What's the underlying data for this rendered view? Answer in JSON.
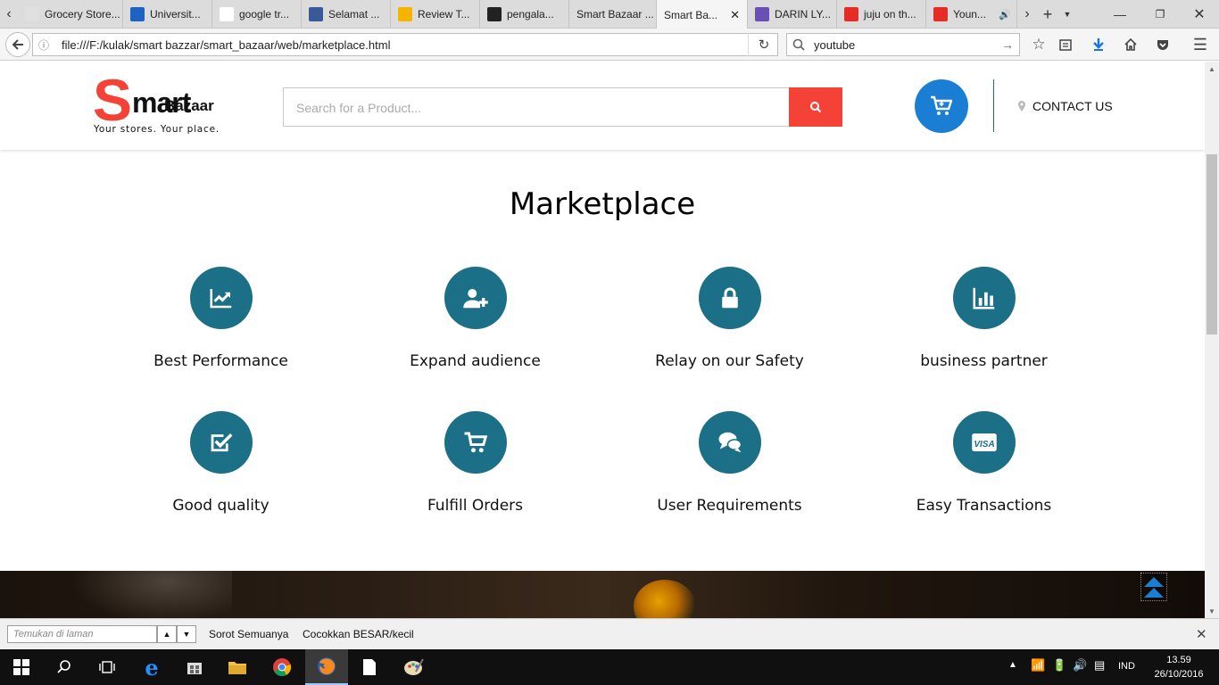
{
  "browser": {
    "tabs": [
      {
        "label": "Grocery Store...",
        "favicon": "grocery-icon",
        "color": "#e0e0e0"
      },
      {
        "label": "Universit...",
        "favicon": "university-icon",
        "color": "#1e63c4"
      },
      {
        "label": "google tr...",
        "favicon": "google-icon",
        "color": "#ffffff"
      },
      {
        "label": "Selamat ...",
        "favicon": "facebook-icon",
        "color": "#3b5998"
      },
      {
        "label": "Review T...",
        "favicon": "star-icon",
        "color": "#f5b400"
      },
      {
        "label": "pengala...",
        "favicon": "github-icon",
        "color": "#222222"
      },
      {
        "label": "Smart Bazaar ...",
        "favicon": "",
        "color": "#dcdcdc"
      },
      {
        "label": "Smart Ba...",
        "favicon": "",
        "color": "#f5f5f5"
      },
      {
        "label": "DARIN LY...",
        "favicon": "az-icon",
        "color": "#6a4fb5"
      },
      {
        "label": "juju on th...",
        "favicon": "youtube-icon",
        "color": "#e52d27"
      },
      {
        "label": "Youn...",
        "favicon": "youtube-icon",
        "color": "#e52d27"
      }
    ],
    "url": "file:///F:/kulak/smart bazzar/smart_bazaar/web/marketplace.html",
    "search_value": "youtube"
  },
  "site": {
    "logo_big": "S",
    "logo_rest": "mart",
    "logo_overlay": "Bazaar",
    "tagline": "Your stores. Your place.",
    "search_placeholder": "Search for a Product...",
    "contact_label": "CONTACT US",
    "accent_red": "#f44336",
    "cart_blue": "#1a7fd4",
    "teal": "#1b6f86"
  },
  "main": {
    "title": "Marketplace",
    "features": [
      {
        "label": "Best Performance",
        "icon": "line-chart-icon"
      },
      {
        "label": "Expand audience",
        "icon": "user-plus-icon"
      },
      {
        "label": "Relay on our Safety",
        "icon": "lock-icon"
      },
      {
        "label": "business partner",
        "icon": "bar-chart-icon"
      },
      {
        "label": "Good quality",
        "icon": "check-square-icon"
      },
      {
        "label": "Fulfill Orders",
        "icon": "shopping-cart-icon"
      },
      {
        "label": "User Requirements",
        "icon": "comments-icon"
      },
      {
        "label": "Easy Transactions",
        "icon": "visa-card-icon"
      }
    ]
  },
  "findbar": {
    "placeholder": "Temukan di laman",
    "highlight_all": "Sorot Semuanya",
    "match_case": "Cocokkan BESAR/kecil"
  },
  "taskbar": {
    "language": "IND",
    "time": "13.59",
    "date": "26/10/2016"
  }
}
